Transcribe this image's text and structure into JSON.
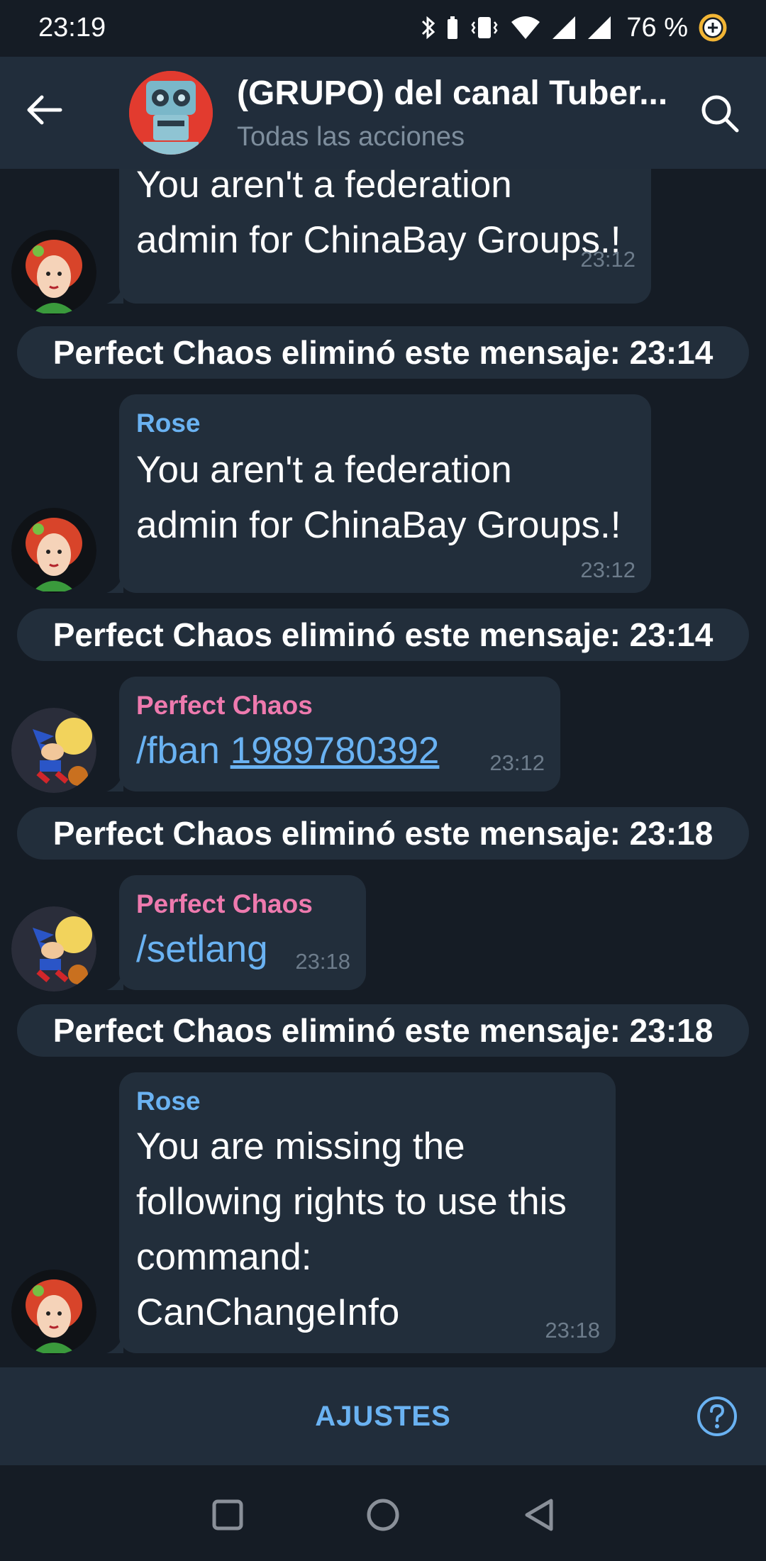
{
  "status_bar": {
    "time": "23:19",
    "battery": "76 %"
  },
  "header": {
    "title": "(GRUPO) del canal Tuber...",
    "subtitle": "Todas las acciones",
    "back_icon": "arrow-left-icon",
    "search_icon": "search-icon"
  },
  "messages": [
    {
      "type": "message",
      "sender": "",
      "lines": [
        "You aren't a federation",
        "admin for ChinaBay Groups.!"
      ],
      "time": "23:12",
      "avatar": "rose"
    },
    {
      "type": "service",
      "text": "Perfect Chaos eliminó este mensaje:  23:14"
    },
    {
      "type": "message",
      "sender": "Rose",
      "lines": [
        "You aren't a federation",
        "admin for ChinaBay Groups.!"
      ],
      "time": "23:12",
      "avatar": "rose"
    },
    {
      "type": "service",
      "text": "Perfect Chaos eliminó este mensaje:  23:14"
    },
    {
      "type": "message",
      "sender": "Perfect Chaos",
      "command": "/fban",
      "command_arg": "1989780392",
      "time": "23:12",
      "avatar": "sonic"
    },
    {
      "type": "service",
      "text": "Perfect Chaos eliminó este mensaje:  23:18"
    },
    {
      "type": "message",
      "sender": "Perfect Chaos",
      "command": "/setlang",
      "time": "23:18",
      "avatar": "sonic"
    },
    {
      "type": "service",
      "text": "Perfect Chaos eliminó este mensaje:  23:18"
    },
    {
      "type": "message",
      "sender": "Rose",
      "lines": [
        "You are missing the",
        "following rights to use this",
        "command:",
        "CanChangeInfo"
      ],
      "time": "23:18",
      "avatar": "rose"
    }
  ],
  "bottom_bar": {
    "label": "AJUSTES",
    "help_icon": "help-circle-icon"
  },
  "colors": {
    "background": "#151c25",
    "header": "#212d3b",
    "bubble": "#222e3b",
    "accent": "#6ab2f2",
    "rose_name": "#6ab2f2",
    "chaos_name": "#ee7aae"
  }
}
